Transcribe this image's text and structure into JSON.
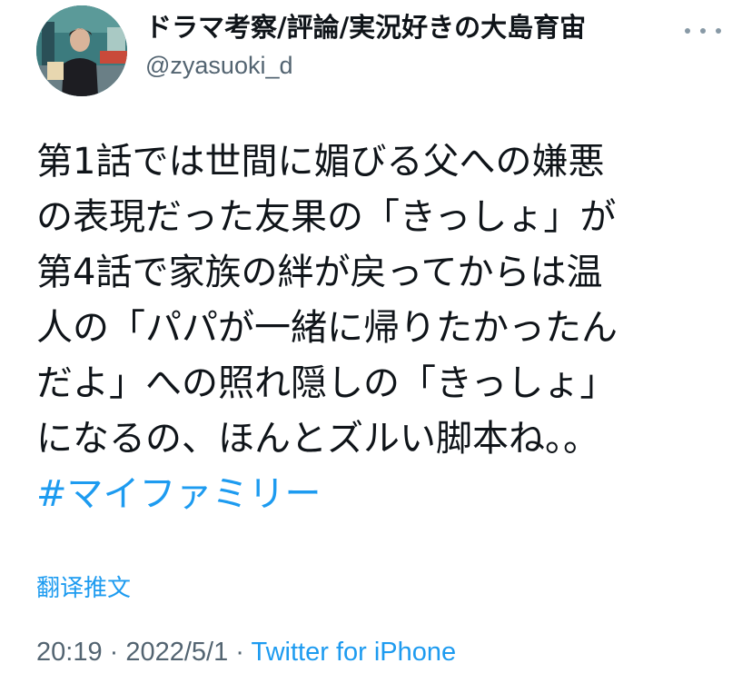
{
  "author": {
    "display_name": "ドラマ考察/評論/実況好きの大島育宙",
    "handle": "@zyasuoki_d",
    "avatar_icon": "profile-photo-icon"
  },
  "more_icon": "more-horizontal-icon",
  "tweet": {
    "lines": [
      "第1話では世間に媚びる父への嫌悪",
      "の表現だった友果の「きっしょ」が",
      "第4話で家族の絆が戻ってからは温",
      "人の「パパが一緒に帰りたかったん",
      "だよ」への照れ隠しの「きっしょ」",
      "になるの、ほんとズルい脚本ね。。"
    ],
    "hashtag": "#マイファミリー"
  },
  "translate_label": "翻译推文",
  "meta": {
    "time": "20:19",
    "sep1": " · ",
    "date": "2022/5/1",
    "sep2": " · ",
    "source": "Twitter for iPhone"
  },
  "colors": {
    "link": "#1d9bf0",
    "text": "#0f1419",
    "secondary": "#536471"
  }
}
